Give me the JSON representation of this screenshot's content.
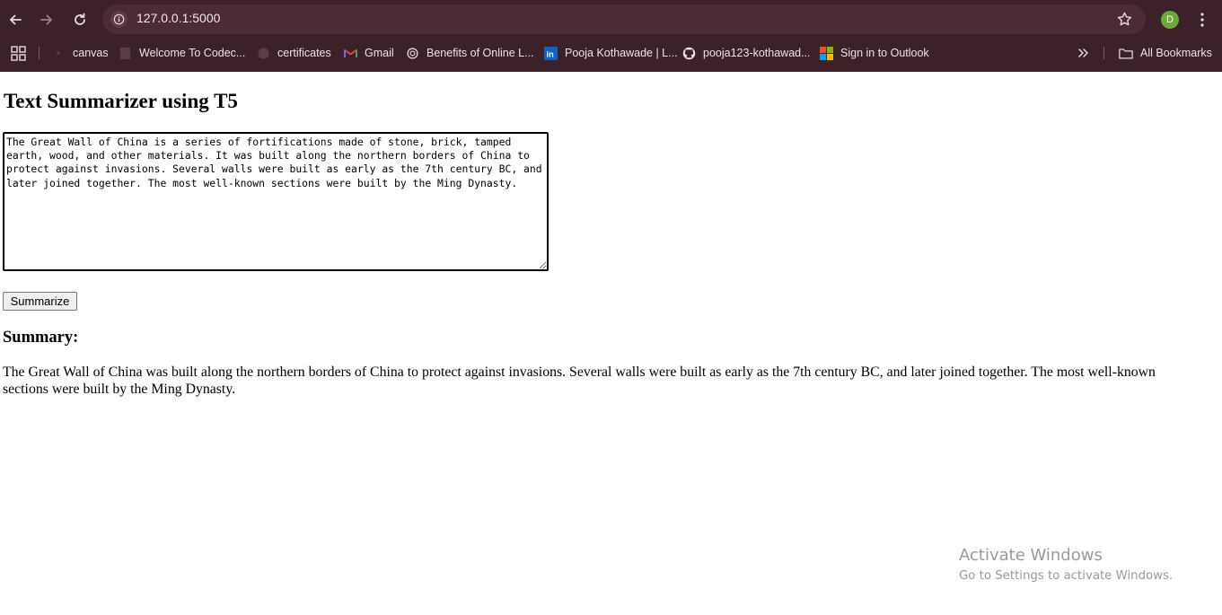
{
  "browser": {
    "url": "127.0.0.1:5000",
    "profile_initial": "D",
    "bookmarks": [
      {
        "label": "canvas",
        "icon": "canvas-icon"
      },
      {
        "label": "Welcome To Codec...",
        "icon": "page-icon"
      },
      {
        "label": "certificates",
        "icon": "globe-icon"
      },
      {
        "label": "Gmail",
        "icon": "gmail-icon"
      },
      {
        "label": "Benefits of Online L...",
        "icon": "openai-icon"
      },
      {
        "label": "Pooja Kothawade | L...",
        "icon": "linkedin-icon"
      },
      {
        "label": "pooja123-kothawad...",
        "icon": "github-icon"
      },
      {
        "label": "Sign in to Outlook",
        "icon": "microsoft-icon"
      }
    ],
    "all_bookmarks_label": "All Bookmarks",
    "colors": {
      "frame": "#3c2128",
      "omnibox": "#4d2b34",
      "profile": "#6ca83a"
    }
  },
  "page": {
    "title": "Text Summarizer using T5",
    "input_text": "The Great Wall of China is a series of fortifications made of stone, brick, tamped earth, wood, and other materials. It was built along the northern borders of China to protect against invasions. Several walls were built as early as the 7th century BC, and later joined together. The most well-known sections were built by the Ming Dynasty.",
    "summarize_label": "Summarize",
    "summary_heading": "Summary:",
    "summary_text": "The Great Wall of China was built along the northern borders of China to protect against invasions. Several walls were built as early as the 7th century BC, and later joined together. The most well-known sections were built by the Ming Dynasty."
  },
  "watermark": {
    "title": "Activate Windows",
    "subtitle": "Go to Settings to activate Windows."
  }
}
